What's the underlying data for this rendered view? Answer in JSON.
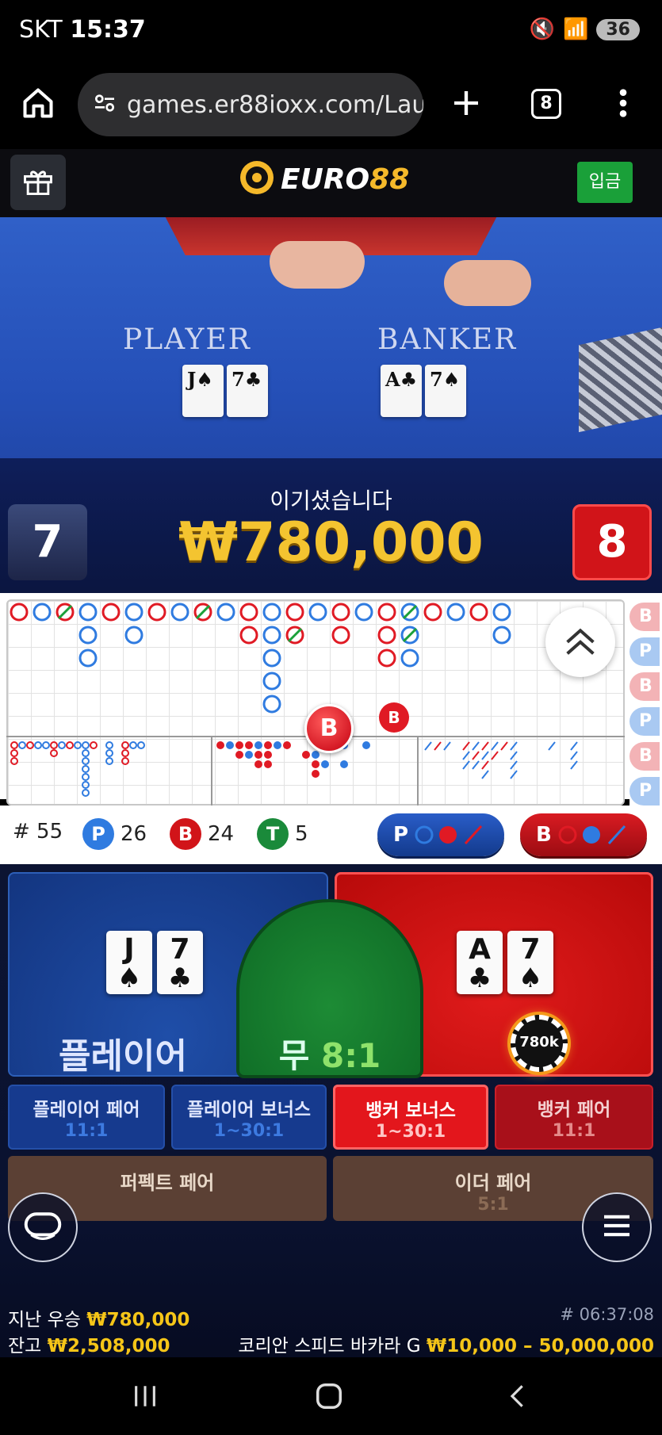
{
  "status_bar": {
    "carrier": "SKT",
    "time": "15:37",
    "battery": "36"
  },
  "browser": {
    "url": "games.er88ioxx.com/Launc",
    "tab_count": "8"
  },
  "header": {
    "logo_text_a": "EURO",
    "logo_text_b": "88",
    "deposit_label": "입금"
  },
  "video": {
    "player_label": "PLAYER",
    "banker_label": "BANKER",
    "player_cards": [
      {
        "rank": "J",
        "suit": "♠"
      },
      {
        "rank": "7",
        "suit": "♣"
      }
    ],
    "banker_cards": [
      {
        "rank": "A",
        "suit": "♣"
      },
      {
        "rank": "7",
        "suit": "♠"
      }
    ]
  },
  "result": {
    "win_text": "이기셨습니다",
    "win_amount": "₩780,000",
    "player_score": "7",
    "banker_score": "8"
  },
  "roadmap": {
    "side_labels": [
      "B",
      "P",
      "B",
      "P",
      "B",
      "P"
    ],
    "marker_big": "B",
    "marker_small": "B"
  },
  "stats": {
    "hands_label": "# 55",
    "player_count": "26",
    "banker_count": "24",
    "tie_count": "5",
    "p_badge": "P",
    "b_badge": "B",
    "t_badge": "T",
    "player_predict": "P",
    "banker_predict": "B"
  },
  "bets": {
    "player_label": "플레이어",
    "tie_label": "무",
    "tie_odds": "8:1",
    "chip_label": "780k",
    "player_cards": [
      {
        "rank": "J",
        "suit": "♠"
      },
      {
        "rank": "7",
        "suit": "♣"
      }
    ],
    "banker_cards": [
      {
        "rank": "A",
        "suit": "♣"
      },
      {
        "rank": "7",
        "suit": "♠"
      }
    ],
    "side_bets": [
      {
        "name": "플레이어 페어",
        "odds": "11:1"
      },
      {
        "name": "플레이어 보너스",
        "odds": "1~30:1"
      },
      {
        "name": "뱅커 보너스",
        "odds": "1~30:1"
      },
      {
        "name": "뱅커 페어",
        "odds": "11:1"
      }
    ],
    "perfect_pair": {
      "name": "퍼펙트 페어",
      "odds": ""
    },
    "either_pair": {
      "name": "이더 페어",
      "odds": "5:1"
    }
  },
  "footer": {
    "last_win_label": "지난 우승",
    "last_win_amount": "₩780,000",
    "balance_label": "잔고",
    "balance_amount": "₩2,508,000",
    "round_id": "# 06:37:08",
    "table_name": "코리안 스피드 바카라 G",
    "limits": "₩10,000 – 50,000,000"
  },
  "colors": {
    "player": "#1f4ea8",
    "banker": "#d11419",
    "tie": "#1d8b35",
    "gold": "#f5c518"
  },
  "icons": [
    "home-icon",
    "site-settings-icon",
    "plus-icon",
    "more-icon",
    "gift-icon",
    "soccer-ball-icon",
    "chevron-up-icon",
    "chat-icon",
    "menu-icon"
  ]
}
